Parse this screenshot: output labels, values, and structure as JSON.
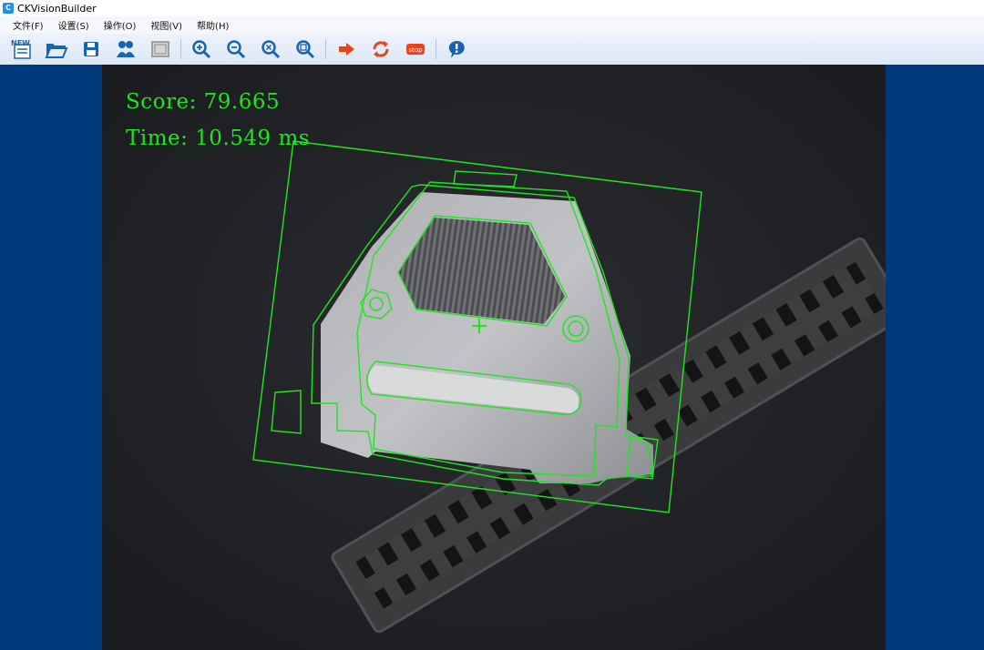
{
  "window": {
    "title": "CKVisionBuilder",
    "app_icon_glyph": "C"
  },
  "menu": [
    {
      "label": "文件(F)"
    },
    {
      "label": "设置(S)"
    },
    {
      "label": "操作(O)"
    },
    {
      "label": "视图(V)"
    },
    {
      "label": "帮助(H)"
    }
  ],
  "toolbar": {
    "new_label": "NEW",
    "stop_label": "stop",
    "buttons": [
      "new-icon",
      "open-folder-icon",
      "save-icon",
      "users-icon",
      "frame-icon",
      "zoom-in-icon",
      "zoom-out-icon",
      "zoom-fit-icon",
      "zoom-actual-icon",
      "run-once-icon",
      "run-loop-icon",
      "stop-icon",
      "info-bubble-icon"
    ]
  },
  "result": {
    "score_text": "Score: 79.665",
    "time_text": "Time: 10.549 ms"
  },
  "colors": {
    "accent": "#1ee61e",
    "background": "#003b7e",
    "image_bg": "#222326",
    "toolbar_blue": "#1764b5",
    "run_red": "#e8431a"
  }
}
